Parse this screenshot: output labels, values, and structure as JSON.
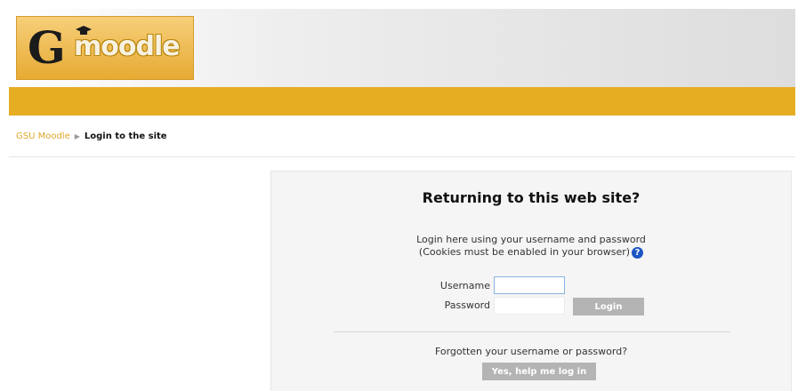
{
  "header": {
    "logo_letter": "G",
    "logo_word": "moodle"
  },
  "breadcrumb": {
    "home": "GSU Moodle",
    "separator": "▶",
    "current": "Login to the site"
  },
  "login": {
    "title": "Returning to this web site?",
    "desc_line1": "Login here using your username and password",
    "desc_line2": "(Cookies must be enabled in your browser)",
    "help_icon": "?",
    "username_label": "Username",
    "username_value": "",
    "password_label": "Password",
    "password_value": "",
    "login_button": "Login",
    "forgot_text": "Forgotten your username or password?",
    "help_button": "Yes, help me log in"
  },
  "colors": {
    "accent": "#e6ad22",
    "link": "#e2a72a",
    "button": "#b4b4b4",
    "help": "#1d55c4"
  }
}
